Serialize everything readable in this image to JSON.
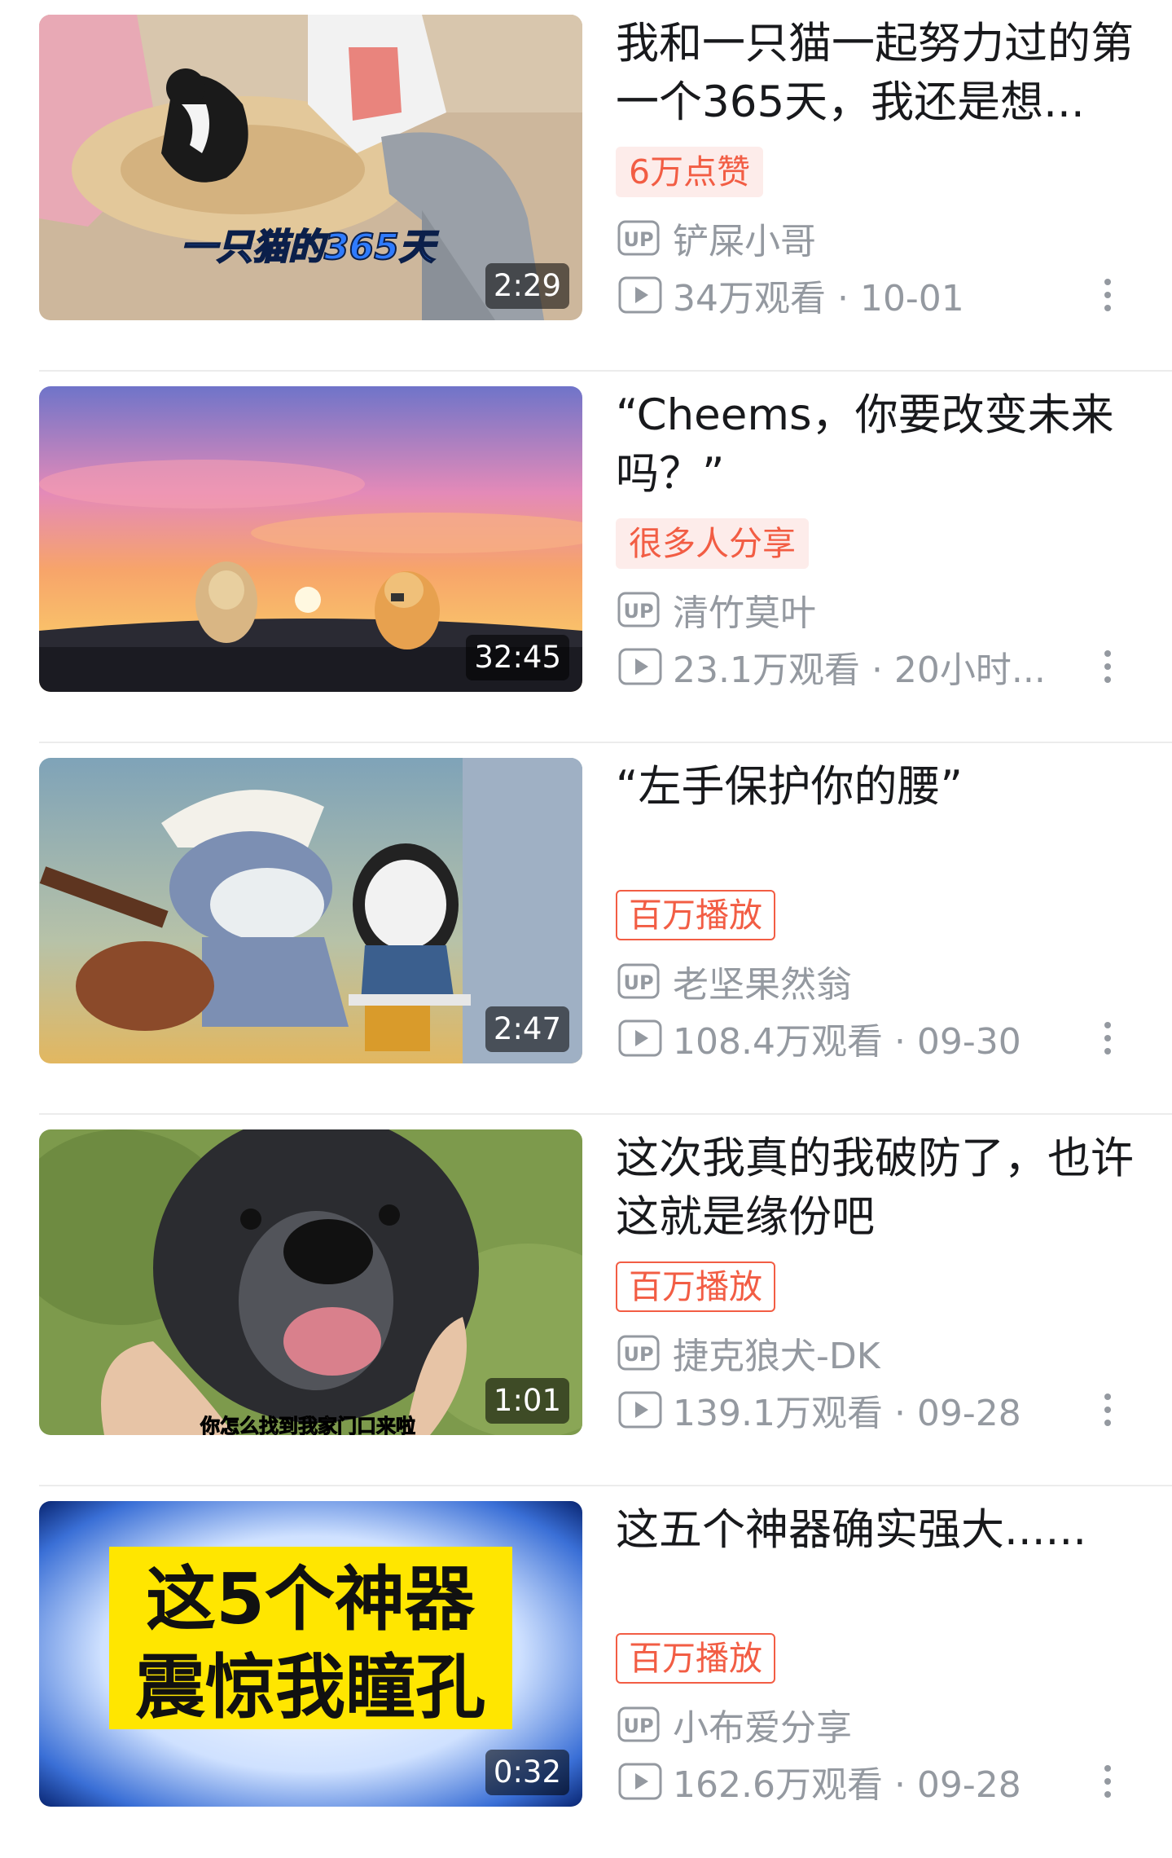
{
  "colors": {
    "accent": "#f25d44",
    "accent_bg": "#fdecea",
    "meta_gray": "#9499a0",
    "title": "#18191c"
  },
  "icons": {
    "uploader": "up-icon",
    "views": "play-icon",
    "more": "more-vertical-icon"
  },
  "videos": [
    {
      "title": "我和一只猫一起努力过的第一个365天，我还是想...",
      "thumb_caption": "一只猫的365天",
      "duration": "2:29",
      "badge": "6万点赞",
      "badge_style": "filled",
      "uploader": "铲屎小哥",
      "stats": "34万观看 · 10-01"
    },
    {
      "title": "“Cheems，你要改变未来吗？”",
      "thumb_caption": "",
      "duration": "32:45",
      "badge": "很多人分享",
      "badge_style": "filled",
      "uploader": "清竹莫叶",
      "stats": "23.1万观看 · 20小时..."
    },
    {
      "title": "“左手保护你的腰”",
      "thumb_caption": "",
      "duration": "2:47",
      "badge": "百万播放",
      "badge_style": "outline",
      "uploader": "老坚果然翁",
      "stats": "108.4万观看 · 09-30"
    },
    {
      "title": "这次我真的我破防了，也许这就是缘份吧",
      "thumb_caption": "你怎么找到我家门口来啦",
      "duration": "1:01",
      "badge": "百万播放",
      "badge_style": "outline",
      "uploader": "捷克狼犬-DK",
      "stats": "139.1万观看 · 09-28"
    },
    {
      "title": "这五个神器确实强大......",
      "thumb_caption": "这5个神器 震惊我瞳孔",
      "thumb_caption_lines": [
        "这5个神器",
        "震惊我瞳孔"
      ],
      "duration": "0:32",
      "badge": "百万播放",
      "badge_style": "outline",
      "uploader": "小布爱分享",
      "stats": "162.6万观看 · 09-28"
    }
  ]
}
